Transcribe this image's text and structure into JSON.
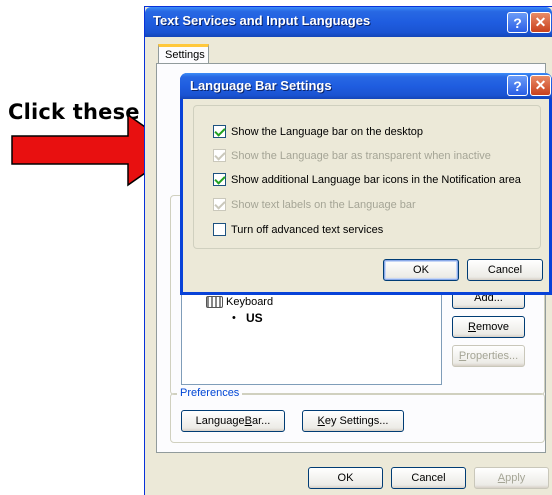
{
  "annotation": {
    "text": "Click these"
  },
  "outer_window": {
    "title": "Text Services and Input Languages",
    "help_glyph": "?",
    "close_glyph": "✕",
    "tab_label": "Settings",
    "installed_services": {
      "keyboard_label": "Keyboard",
      "bullet": "•",
      "layout_label": "US"
    },
    "buttons": {
      "add": "Add...",
      "remove_pre": "",
      "remove_ul": "R",
      "remove_post": "emove",
      "properties_pre": "",
      "properties_ul": "P",
      "properties_post": "roperties..."
    },
    "preferences": {
      "label": "Preferences",
      "language_bar_pre": "Language ",
      "language_bar_ul": "B",
      "language_bar_post": "ar...",
      "key_settings_pre": "",
      "key_settings_ul": "K",
      "key_settings_post": "ey Settings..."
    },
    "footer": {
      "ok": "OK",
      "cancel": "Cancel",
      "apply_pre": "",
      "apply_ul": "A",
      "apply_post": "pply"
    }
  },
  "dialog": {
    "title": "Language Bar Settings",
    "help_glyph": "?",
    "close_glyph": "✕",
    "options": [
      {
        "label": "Show the Language bar on the desktop",
        "checked": true,
        "enabled": true
      },
      {
        "label": "Show the Language bar as transparent when inactive",
        "checked": true,
        "enabled": false
      },
      {
        "label": "Show additional Language bar icons in the Notification area",
        "checked": true,
        "enabled": true
      },
      {
        "label": "Show text labels on the Language bar",
        "checked": true,
        "enabled": false
      },
      {
        "label": "Turn off advanced text services",
        "checked": false,
        "enabled": true
      }
    ],
    "ok": "OK",
    "cancel": "Cancel"
  },
  "colors": {
    "arrow": "#e81010",
    "title_blue": "#0842d8",
    "dialog_bg": "#ece9d8"
  }
}
